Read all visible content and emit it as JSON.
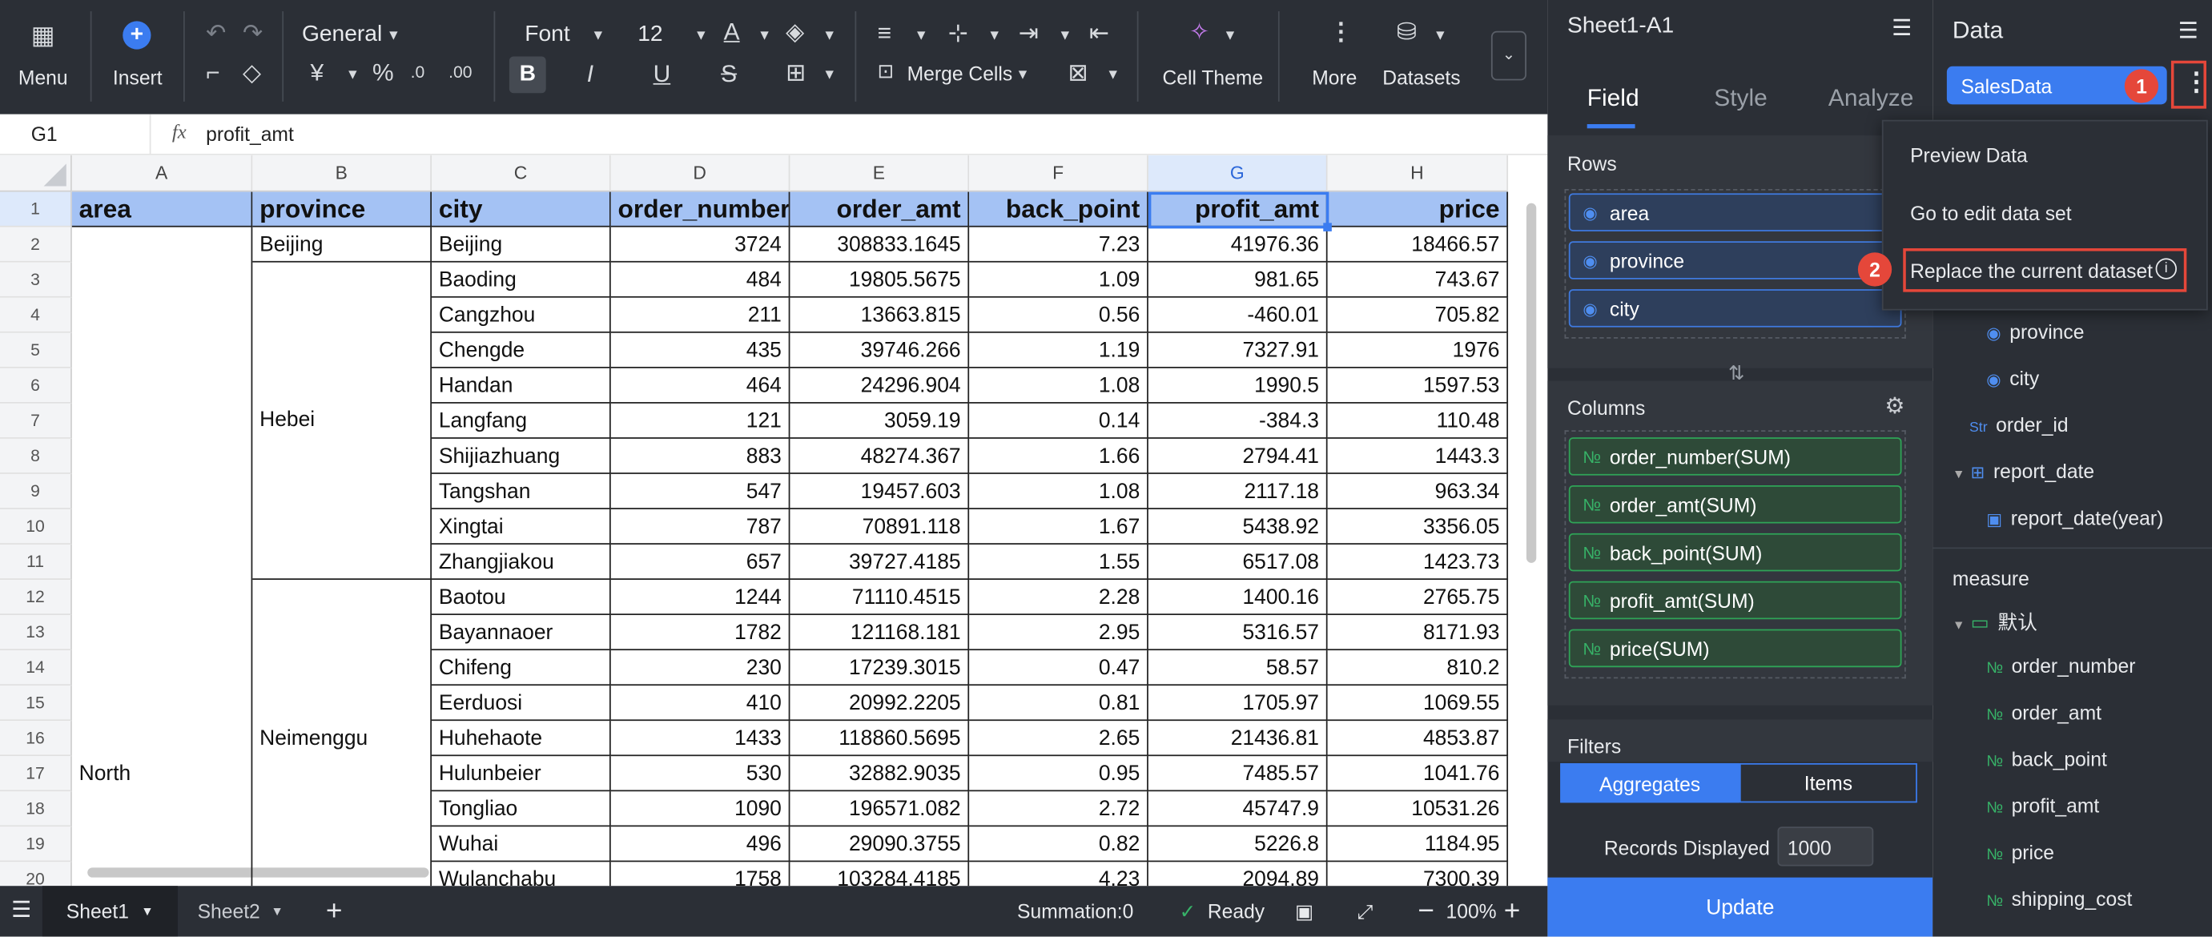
{
  "toolbar": {
    "menu": "Menu",
    "insert": "Insert",
    "number_format": "General",
    "font": "Font",
    "font_size": "12",
    "merge_cells": "Merge Cells",
    "cell_theme": "Cell Theme",
    "more": "More",
    "datasets": "Datasets"
  },
  "formula_bar": {
    "cell_ref": "G1",
    "fx": "fx",
    "value": "profit_amt"
  },
  "columns": [
    "A",
    "B",
    "C",
    "D",
    "E",
    "F",
    "G",
    "H"
  ],
  "rows": [
    "1",
    "2",
    "3",
    "4",
    "5",
    "6",
    "7",
    "8",
    "9",
    "10",
    "11",
    "12",
    "13",
    "14",
    "15",
    "16",
    "17",
    "18",
    "19",
    "20"
  ],
  "headers": [
    "area",
    "province",
    "city",
    "order_number",
    "order_amt",
    "back_point",
    "profit_amt",
    "price"
  ],
  "merged": {
    "area": "North",
    "beijing": "Beijing",
    "hebei": "Hebei",
    "neimenggu": "Neimenggu"
  },
  "data_rows": [
    [
      "Beijing",
      "3724",
      "308833.1645",
      "7.23",
      "41976.36",
      "18466.57"
    ],
    [
      "Baoding",
      "484",
      "19805.5675",
      "1.09",
      "981.65",
      "743.67"
    ],
    [
      "Cangzhou",
      "211",
      "13663.815",
      "0.56",
      "-460.01",
      "705.82"
    ],
    [
      "Chengde",
      "435",
      "39746.266",
      "1.19",
      "7327.91",
      "1976"
    ],
    [
      "Handan",
      "464",
      "24296.904",
      "1.08",
      "1990.5",
      "1597.53"
    ],
    [
      "Langfang",
      "121",
      "3059.19",
      "0.14",
      "-384.3",
      "110.48"
    ],
    [
      "Shijiazhuang",
      "883",
      "48274.367",
      "1.66",
      "2794.41",
      "1443.3"
    ],
    [
      "Tangshan",
      "547",
      "19457.603",
      "1.08",
      "2117.18",
      "963.34"
    ],
    [
      "Xingtai",
      "787",
      "70891.118",
      "1.67",
      "5438.92",
      "3356.05"
    ],
    [
      "Zhangjiakou",
      "657",
      "39727.4185",
      "1.55",
      "6517.08",
      "1423.73"
    ],
    [
      "Baotou",
      "1244",
      "71110.4515",
      "2.28",
      "1400.16",
      "2765.75"
    ],
    [
      "Bayannaoer",
      "1782",
      "121168.181",
      "2.95",
      "5316.57",
      "8171.93"
    ],
    [
      "Chifeng",
      "230",
      "17239.3015",
      "0.47",
      "58.57",
      "810.2"
    ],
    [
      "Eerduosi",
      "410",
      "20992.2205",
      "0.81",
      "1705.97",
      "1069.55"
    ],
    [
      "Huhehaote",
      "1433",
      "118860.5695",
      "2.65",
      "21436.81",
      "4853.87"
    ],
    [
      "Hulunbeier",
      "530",
      "32882.9035",
      "0.95",
      "7485.57",
      "1041.76"
    ],
    [
      "Tongliao",
      "1090",
      "196571.082",
      "2.72",
      "45747.9",
      "10531.26"
    ],
    [
      "Wuhai",
      "496",
      "29090.3755",
      "0.82",
      "5226.8",
      "1184.95"
    ],
    [
      "Wulanchabu",
      "1758",
      "103284.4185",
      "4.23",
      "2094.89",
      "7300.39"
    ]
  ],
  "status": {
    "sheet1": "Sheet1",
    "sheet2": "Sheet2",
    "summation": "Summation:0",
    "ready": "Ready",
    "zoom": "100%"
  },
  "panel": {
    "title": "Sheet1-A1",
    "tabs": [
      "Field",
      "Style",
      "Analyze"
    ],
    "rows_label": "Rows",
    "row_fields": [
      "area",
      "province",
      "city"
    ],
    "columns_label": "Columns",
    "column_fields": [
      "order_number(SUM)",
      "order_amt(SUM)",
      "back_point(SUM)",
      "profit_amt(SUM)",
      "price(SUM)"
    ],
    "filters_label": "Filters",
    "aggregates": "Aggregates",
    "items": "Items",
    "records_label": "Records Displayed",
    "records_value": "1000",
    "update": "Update"
  },
  "data_panel": {
    "title": "Data",
    "dataset": "SalesData",
    "dims": [
      "province",
      "city",
      "order_id",
      "report_date",
      "report_date(year)"
    ],
    "measure_label": "measure",
    "folder": "默认",
    "measures": [
      "order_number",
      "order_amt",
      "back_point",
      "profit_amt",
      "price",
      "shipping_cost"
    ]
  },
  "context_menu": {
    "items": [
      "Preview Data",
      "Go to edit data set",
      "Replace the current dataset"
    ]
  },
  "badges": [
    "1",
    "2"
  ],
  "colors": {
    "accent": "#3b7cf0",
    "header_fill": "#a4c2f4",
    "badge": "#e5473a"
  }
}
